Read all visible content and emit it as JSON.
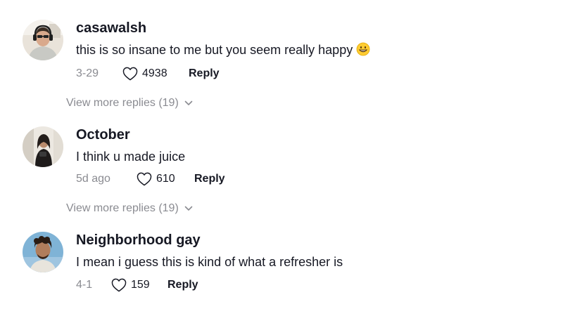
{
  "comments": [
    {
      "username": "casawalsh",
      "text": "this is so insane to me but you seem really happy",
      "emoji": "grinning-face-with-teeth",
      "date": "3-29",
      "likes": "4938",
      "reply_label": "Reply",
      "view_more": "View more replies (19)"
    },
    {
      "username": "October",
      "text": "I think u made juice",
      "date": "5d ago",
      "likes": "610",
      "reply_label": "Reply",
      "view_more": "View more replies (19)"
    },
    {
      "username": "Neighborhood gay",
      "text": "I mean i guess this is kind of what a refresher is",
      "date": "4-1",
      "likes": "159",
      "reply_label": "Reply"
    }
  ],
  "colors": {
    "primary_text": "#161823",
    "secondary_text": "#8a8b91",
    "background": "#ffffff"
  },
  "icons": {
    "like": "heart-outline-icon",
    "expand": "chevron-down-icon"
  }
}
